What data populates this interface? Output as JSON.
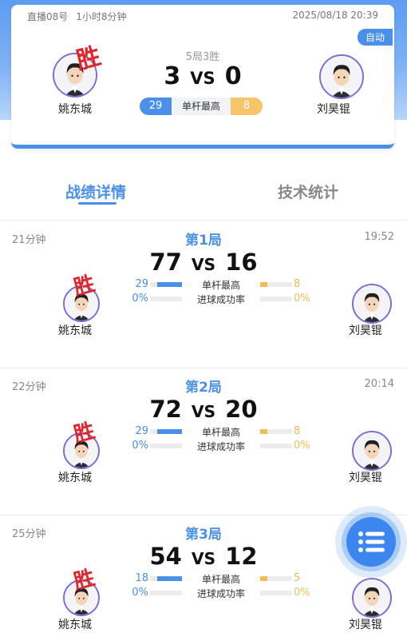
{
  "header": {
    "room": "直播08号",
    "duration": "1小时8分钟",
    "datetime": "2025/08/18 20:39",
    "auto_label": "自动",
    "format": "5局3胜",
    "score_left": "3",
    "score_vs": "VS",
    "score_right": "0",
    "winner_mark": "胜",
    "player_left": "姚东城",
    "player_right": "刘昊锟",
    "high_break_left": "29",
    "high_break_label": "单杆最高",
    "high_break_right": "8"
  },
  "tabs": [
    {
      "label": "战绩详情",
      "active": true
    },
    {
      "label": "技术统计",
      "active": false
    }
  ],
  "games": [
    {
      "duration": "21分钟",
      "title": "第1局",
      "time": "19:52",
      "score_left": "77",
      "vs": "VS",
      "score_right": "16",
      "winner_mark": "胜",
      "player_left": "姚东城",
      "player_right": "刘昊锟",
      "stats": [
        {
          "left": "29",
          "label": "单杆最高",
          "right": "8",
          "left_fill": 0.78,
          "right_fill": 0.22
        },
        {
          "left": "0%",
          "label": "进球成功率",
          "right": "0%",
          "left_fill": 0,
          "right_fill": 0
        }
      ]
    },
    {
      "duration": "22分钟",
      "title": "第2局",
      "time": "20:14",
      "score_left": "72",
      "vs": "VS",
      "score_right": "20",
      "winner_mark": "胜",
      "player_left": "姚东城",
      "player_right": "刘昊锟",
      "stats": [
        {
          "left": "29",
          "label": "单杆最高",
          "right": "8",
          "left_fill": 0.78,
          "right_fill": 0.22
        },
        {
          "left": "0%",
          "label": "进球成功率",
          "right": "0%",
          "left_fill": 0,
          "right_fill": 0
        }
      ]
    },
    {
      "duration": "25分钟",
      "title": "第3局",
      "time": "",
      "score_left": "54",
      "vs": "VS",
      "score_right": "12",
      "winner_mark": "胜",
      "player_left": "姚东城",
      "player_right": "刘昊锟",
      "stats": [
        {
          "left": "18",
          "label": "单杆最高",
          "right": "5",
          "left_fill": 0.78,
          "right_fill": 0.22
        },
        {
          "left": "0%",
          "label": "进球成功率",
          "right": "0%",
          "left_fill": 0,
          "right_fill": 0
        }
      ]
    }
  ],
  "fab": {
    "icon": "list-icon"
  },
  "colors": {
    "accent": "#4a90e8",
    "win": "#e0262c",
    "right_stat": "#f0bd55"
  }
}
